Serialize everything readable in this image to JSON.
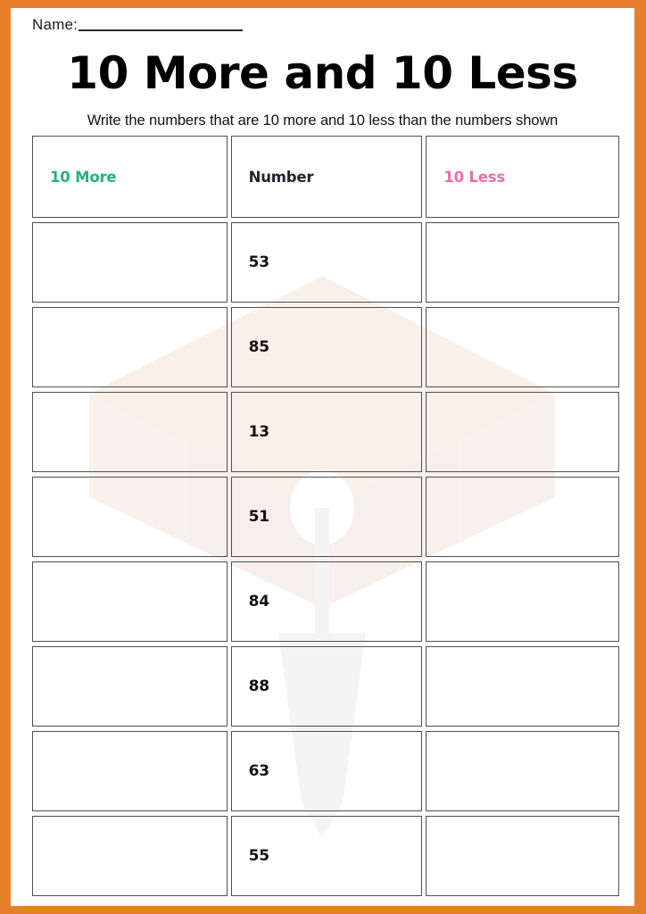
{
  "page": {
    "border_color": "#e8802b",
    "background": "#ffffff"
  },
  "header": {
    "name_label": "Name:",
    "title": "10 More and 10 Less",
    "instruction": "Write the numbers that are 10 more and 10 less than the numbers shown"
  },
  "watermark": {
    "icon": "graduation-cap-watermark",
    "color": "#faf1ec"
  },
  "table": {
    "columns": [
      {
        "key": "more",
        "label": "10 More",
        "color": "#22b573"
      },
      {
        "key": "number",
        "label": "Number",
        "color": "#1d262e"
      },
      {
        "key": "less",
        "label": "10 Less",
        "color": "#ef6ca9"
      }
    ],
    "rows": [
      {
        "more": "",
        "number": "53",
        "less": ""
      },
      {
        "more": "",
        "number": "85",
        "less": ""
      },
      {
        "more": "",
        "number": "13",
        "less": ""
      },
      {
        "more": "",
        "number": "51",
        "less": ""
      },
      {
        "more": "",
        "number": "84",
        "less": ""
      },
      {
        "more": "",
        "number": "88",
        "less": ""
      },
      {
        "more": "",
        "number": "63",
        "less": ""
      },
      {
        "more": "",
        "number": "55",
        "less": ""
      }
    ]
  }
}
